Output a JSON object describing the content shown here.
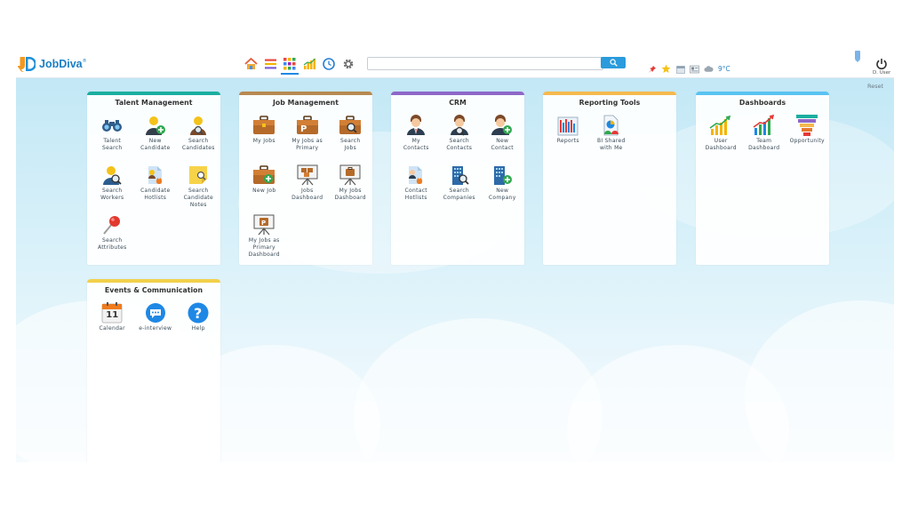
{
  "app": {
    "logo_mark": "JD",
    "logo_text": "JobDiva",
    "logo_reg": "®"
  },
  "toolbar": {
    "nav_icons": [
      "home-icon",
      "list-icon",
      "grid-apps-icon",
      "bar-chart-icon",
      "clock-icon",
      "gear-icon"
    ],
    "search_placeholder": "",
    "search_value": "",
    "weather": "9°C",
    "user": "D. User"
  },
  "main": {
    "reset_label": "Reset"
  },
  "colors": {
    "talent": "#1aaea0",
    "job": "#b88950",
    "crm": "#8e68c8",
    "reporting": "#f5b94e",
    "dashboards": "#59c3f2",
    "events": "#f2d04b",
    "accent": "#2a9bdc"
  },
  "panels": {
    "talent": {
      "title": "Talent Management",
      "items": [
        {
          "l1": "Talent",
          "l2": "Search",
          "l3": "",
          "icon": "binoculars-icon"
        },
        {
          "l1": "New",
          "l2": "Candidate",
          "l3": "",
          "icon": "add-person-icon"
        },
        {
          "l1": "Search",
          "l2": "Candidates",
          "l3": "",
          "icon": "search-person-icon"
        },
        {
          "l1": "Search",
          "l2": "Workers",
          "l3": "",
          "icon": "worker-search-icon"
        },
        {
          "l1": "Candidate",
          "l2": "Hotlists",
          "l3": "",
          "icon": "hotlist-icon"
        },
        {
          "l1": "Search",
          "l2": "Candidate",
          "l3": "Notes",
          "icon": "sticky-note-search-icon"
        },
        {
          "l1": "Search",
          "l2": "Attributes",
          "l3": "",
          "icon": "pin-search-icon"
        }
      ]
    },
    "job": {
      "title": "Job Management",
      "items": [
        {
          "l1": "My Jobs",
          "l2": "",
          "l3": "",
          "icon": "briefcase-icon"
        },
        {
          "l1": "My Jobs as",
          "l2": "Primary",
          "l3": "",
          "icon": "briefcase-p-icon"
        },
        {
          "l1": "Search",
          "l2": "Jobs",
          "l3": "",
          "icon": "briefcase-search-icon"
        },
        {
          "l1": "New Job",
          "l2": "",
          "l3": "",
          "icon": "briefcase-add-icon"
        },
        {
          "l1": "Jobs",
          "l2": "Dashboard",
          "l3": "",
          "icon": "easel-icon"
        },
        {
          "l1": "My Jobs",
          "l2": "Dashboard",
          "l3": "",
          "icon": "easel-briefcase-icon"
        },
        {
          "l1": "My Jobs as",
          "l2": "Primary",
          "l3": "Dashboard",
          "icon": "easel-p-icon"
        }
      ]
    },
    "crm": {
      "title": "CRM",
      "items": [
        {
          "l1": "My",
          "l2": "Contacts",
          "l3": "",
          "icon": "contact-person-icon"
        },
        {
          "l1": "Search",
          "l2": "Contacts",
          "l3": "",
          "icon": "contact-search-icon"
        },
        {
          "l1": "New",
          "l2": "Contact",
          "l3": "",
          "icon": "contact-add-icon"
        },
        {
          "l1": "Contact",
          "l2": "Hotlists",
          "l3": "",
          "icon": "contact-hotlist-icon"
        },
        {
          "l1": "Search",
          "l2": "Companies",
          "l3": "",
          "icon": "building-search-icon"
        },
        {
          "l1": "New",
          "l2": "Company",
          "l3": "",
          "icon": "building-add-icon"
        }
      ]
    },
    "reporting": {
      "title": "Reporting Tools",
      "items": [
        {
          "l1": "Reports",
          "l2": "",
          "l3": "",
          "icon": "report-chart-icon"
        },
        {
          "l1": "BI Shared",
          "l2": "with Me",
          "l3": "",
          "icon": "bi-share-icon"
        }
      ]
    },
    "dashboards": {
      "title": "Dashboards",
      "items": [
        {
          "l1": "User",
          "l2": "Dashboard",
          "l3": "",
          "icon": "growth-chart-icon"
        },
        {
          "l1": "Team",
          "l2": "Dashboard",
          "l3": "",
          "icon": "team-chart-icon"
        },
        {
          "l1": "Opportunity",
          "l2": "",
          "l3": "",
          "icon": "funnel-icon"
        }
      ]
    },
    "events": {
      "title": "Events & Communication",
      "items": [
        {
          "l1": "Calendar",
          "l2": "",
          "l3": "",
          "icon": "calendar-icon",
          "num": "11"
        },
        {
          "l1": "e-interview",
          "l2": "",
          "l3": "",
          "icon": "chat-bubble-icon"
        },
        {
          "l1": "Help",
          "l2": "",
          "l3": "",
          "icon": "help-icon"
        }
      ]
    }
  }
}
